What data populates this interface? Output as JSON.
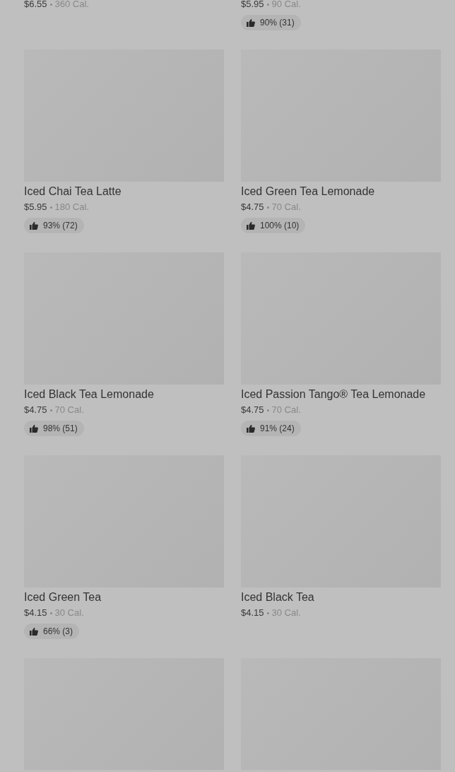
{
  "items": [
    {
      "kind": "top-cut",
      "price": "$6.55",
      "calories": "360 Cal."
    },
    {
      "kind": "top-cut",
      "price": "$5.95",
      "calories": "90 Cal.",
      "rating": "90% (31)"
    },
    {
      "kind": "full",
      "name": "Iced Chai Tea Latte",
      "price": "$5.95",
      "calories": "180 Cal.",
      "rating": "93% (72)"
    },
    {
      "kind": "full",
      "name": "Iced Green Tea Lemonade",
      "price": "$4.75",
      "calories": "70 Cal.",
      "rating": "100% (10)"
    },
    {
      "kind": "full",
      "name": "Iced Black Tea Lemonade",
      "price": "$4.75",
      "calories": "70 Cal.",
      "rating": "98% (51)"
    },
    {
      "kind": "full",
      "name": "Iced Passion Tango® Tea Lemonade",
      "price": "$4.75",
      "calories": "70 Cal.",
      "rating": "91% (24)"
    },
    {
      "kind": "full",
      "name": "Iced Green Tea",
      "price": "$4.15",
      "calories": "30 Cal.",
      "rating": "66% (3)"
    },
    {
      "kind": "full",
      "name": "Iced Black Tea",
      "price": "$4.15",
      "calories": "30 Cal."
    },
    {
      "kind": "bottom-cut"
    },
    {
      "kind": "bottom-cut"
    }
  ]
}
